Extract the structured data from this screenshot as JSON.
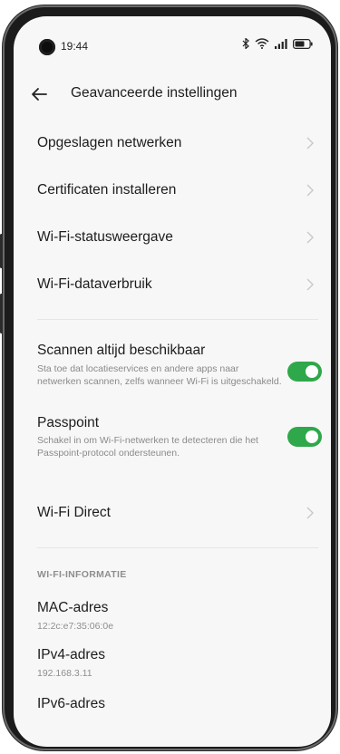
{
  "status_bar": {
    "time": "19:44",
    "icons": [
      "bluetooth-icon",
      "wifi-icon",
      "signal-icon",
      "battery-icon"
    ]
  },
  "header": {
    "back_icon": "arrow-left-icon",
    "title": "Geavanceerde instellingen"
  },
  "menu": {
    "saved_networks": "Opgeslagen netwerken",
    "install_certificates": "Certificaten installeren",
    "wifi_status_display": "Wi-Fi-statusweergave",
    "wifi_data_usage": "Wi-Fi-dataverbruik"
  },
  "toggles": {
    "scanning": {
      "label": "Scannen altijd beschikbaar",
      "description": "Sta toe dat locatieservices en andere apps naar netwerken scannen, zelfs wanneer Wi-Fi is uitgeschakeld.",
      "enabled": true
    },
    "passpoint": {
      "label": "Passpoint",
      "description": "Schakel in om Wi-Fi-netwerken te detecteren die het Passpoint-protocol ondersteunen.",
      "enabled": true
    }
  },
  "wifi_direct": "Wi-Fi Direct",
  "info": {
    "header": "WI-FI-INFORMATIE",
    "mac_label": "MAC-adres",
    "mac_value": "12:2c:e7:35:06:0e",
    "ipv4_label": "IPv4-adres",
    "ipv4_value": "192.168.3.11",
    "ipv6_label": "IPv6-adres"
  },
  "colors": {
    "toggle_on": "#2ea84a",
    "screen_bg": "#f7f7f7",
    "text_primary": "#1d1d1d",
    "text_secondary": "#8a8a8a"
  }
}
